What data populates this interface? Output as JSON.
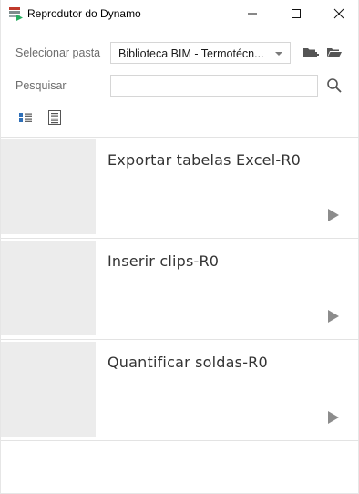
{
  "window": {
    "title": "Reprodutor do Dynamo",
    "icons": {
      "app": "dynamo-app-icon",
      "minimize": "minimize-icon",
      "maximize": "maximize-icon",
      "close": "close-icon"
    }
  },
  "toolbar": {
    "folder_label": "Selecionar pasta",
    "folder_value": "Biblioteca BIM - Termotécn...",
    "search_label": "Pesquisar",
    "search_value": "",
    "search_placeholder": "",
    "icons": {
      "add_folder": "add-folder-icon",
      "open_folder": "open-folder-icon",
      "search": "search-icon",
      "view_detail": "detail-view-icon",
      "view_list": "list-view-icon"
    }
  },
  "scripts": [
    {
      "name": "Exportar tabelas Excel-R0",
      "action": "play-icon"
    },
    {
      "name": "Inserir clips-R0",
      "action": "play-icon"
    },
    {
      "name": "Quantificar soldas-R0",
      "action": "play-icon"
    }
  ],
  "colors": {
    "accent": "#2f6fb7",
    "thumbnail": "#ececec",
    "text": "#333333",
    "label": "#6e6e6e"
  }
}
